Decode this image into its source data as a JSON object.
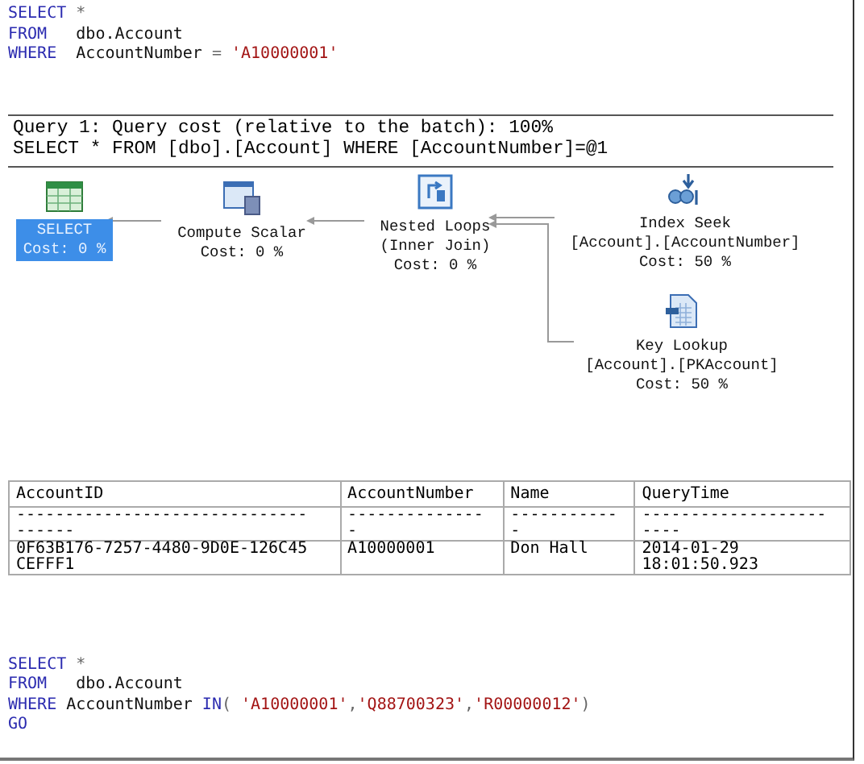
{
  "query_top": {
    "lines": [
      [
        {
          "text": "SELECT",
          "kind": "keyword"
        },
        {
          "text": " *",
          "kind": "operator"
        }
      ],
      [
        {
          "text": "FROM",
          "kind": "keyword"
        },
        {
          "text": "   dbo.Account",
          "kind": "plain"
        }
      ],
      [
        {
          "text": "WHERE",
          "kind": "keyword"
        },
        {
          "text": "  AccountNumber ",
          "kind": "plain"
        },
        {
          "text": "=",
          "kind": "operator"
        },
        {
          "text": " 'A10000001'",
          "kind": "string"
        }
      ]
    ]
  },
  "execution_plan": {
    "header": [
      "Query 1: Query cost (relative to the batch): 100%",
      "SELECT * FROM [dbo].[Account] WHERE [AccountNumber]=@1"
    ],
    "nodes": [
      {
        "kind": "select",
        "lines": [
          "SELECT",
          "Cost: 0 %"
        ],
        "selected": true
      },
      {
        "kind": "compute_scalar",
        "lines": [
          "Compute Scalar",
          "Cost: 0 %"
        ],
        "selected": false
      },
      {
        "kind": "nested_loops",
        "lines": [
          "Nested Loops",
          "(Inner Join)",
          "Cost: 0 %"
        ],
        "selected": false
      },
      {
        "kind": "index_seek",
        "lines": [
          "Index Seek",
          "[Account].[AccountNumber]",
          "Cost: 50 %"
        ],
        "selected": false
      },
      {
        "kind": "key_lookup",
        "lines": [
          "Key Lookup",
          "[Account].[PKAccount]",
          "Cost: 50 %"
        ],
        "selected": false
      }
    ]
  },
  "results": {
    "columns": [
      "AccountID",
      "AccountNumber",
      "Name",
      "QueryTime"
    ],
    "rows": [
      [
        "------------------------------\n------",
        "--------------\n-",
        "-----------\n-",
        "-------------------\n----"
      ],
      [
        "0F63B176-7257-4480-9D0E-126C45\nCEFFF1",
        "A10000001",
        "Don Hall",
        "2014-01-29\n18:01:50.923"
      ]
    ]
  },
  "query_bottom": {
    "lines": [
      [
        {
          "text": "SELECT",
          "kind": "keyword"
        },
        {
          "text": " *",
          "kind": "operator"
        }
      ],
      [
        {
          "text": "FROM",
          "kind": "keyword"
        },
        {
          "text": "   dbo.Account",
          "kind": "plain"
        }
      ],
      [
        {
          "text": "WHERE",
          "kind": "keyword"
        },
        {
          "text": " AccountNumber ",
          "kind": "plain"
        },
        {
          "text": "IN",
          "kind": "keyword"
        },
        {
          "text": "( ",
          "kind": "operator"
        },
        {
          "text": "'A10000001'",
          "kind": "string"
        },
        {
          "text": ",",
          "kind": "operator"
        },
        {
          "text": "'Q88700323'",
          "kind": "string"
        },
        {
          "text": ",",
          "kind": "operator"
        },
        {
          "text": "'R00000012'",
          "kind": "string"
        },
        {
          "text": ")",
          "kind": "operator"
        }
      ],
      [
        {
          "text": "GO",
          "kind": "keyword"
        }
      ]
    ]
  }
}
